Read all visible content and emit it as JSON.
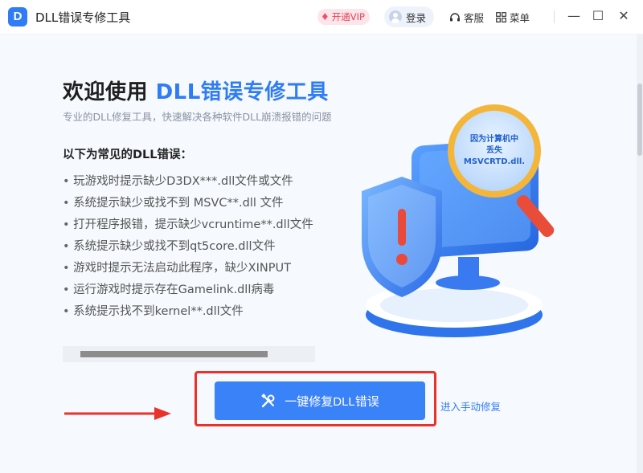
{
  "titlebar": {
    "app_title": "DLL错误专修工具",
    "vip_label": "开通VIP",
    "login_label": "登录",
    "service_label": "客服",
    "menu_label": "菜单"
  },
  "hero": {
    "title_prefix": "欢迎使用 ",
    "title_accent": "DLL错误专修工具",
    "subtitle": "专业的DLL修复工具，快速解决各种软件DLL崩溃报错的问题"
  },
  "common_errors": {
    "title": "以下为常见的DLL错误：",
    "items": [
      "玩游戏时提示缺少D3DX***.dll文件或文件",
      "系统提示缺少或找不到 MSVC**.dll 文件",
      "打开程序报错，提示缺少vcruntime**.dll文件",
      "系统提示缺少或找不到qt5core.dll文件",
      "游戏时提示无法启动此程序，缺少XINPUT",
      "运行游戏时提示存在Gamelink.dll病毒",
      "系统提示找不到kernel**.dll文件"
    ]
  },
  "illustration": {
    "magnifier_text_line1": "因为计算机中",
    "magnifier_text_line2": "丢失",
    "magnifier_text_line3": "MSVCRTD.dll."
  },
  "actions": {
    "fix_button_label": "一键修复DLL错误",
    "manual_link_label": "进入手动修复"
  },
  "colors": {
    "accent": "#2f7cf6",
    "highlight": "#e8322b"
  }
}
